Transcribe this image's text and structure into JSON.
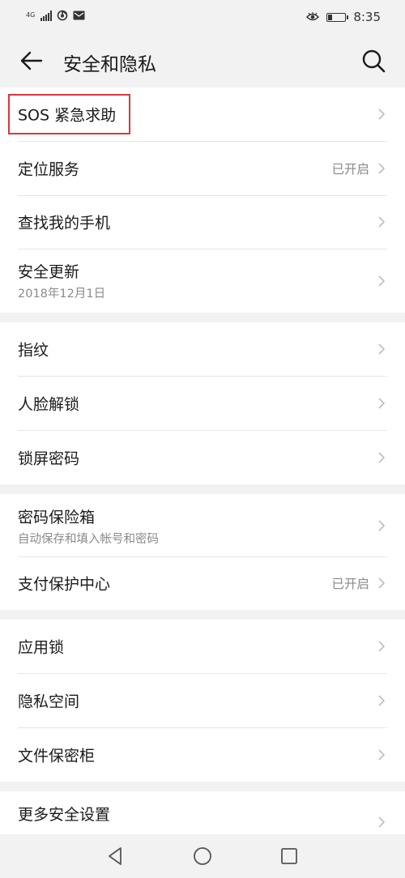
{
  "status_bar": {
    "network": "4G",
    "time": "8:35",
    "battery_level": 0.25,
    "icons": [
      "signal-icon",
      "hotspot-icon",
      "message-icon",
      "eye-comfort-icon",
      "battery-icon"
    ]
  },
  "header": {
    "title": "安全和隐私",
    "back_icon": "arrow-left-icon",
    "search_icon": "search-icon"
  },
  "groups": [
    {
      "items": [
        {
          "label": "SOS 紧急求助",
          "highlighted": true
        },
        {
          "label": "定位服务",
          "value": "已开启"
        },
        {
          "label": "查找我的手机"
        },
        {
          "label": "安全更新",
          "subtitle": "2018年12月1日"
        }
      ]
    },
    {
      "items": [
        {
          "label": "指纹"
        },
        {
          "label": "人脸解锁"
        },
        {
          "label": "锁屏密码"
        }
      ]
    },
    {
      "items": [
        {
          "label": "密码保险箱",
          "subtitle": "自动保存和填入帐号和密码"
        },
        {
          "label": "支付保护中心",
          "value": "已开启"
        }
      ]
    },
    {
      "items": [
        {
          "label": "应用锁"
        },
        {
          "label": "隐私空间"
        },
        {
          "label": "文件保密柜"
        }
      ]
    },
    {
      "items": [
        {
          "label": "更多安全设置"
        }
      ]
    }
  ],
  "nav_bar": {
    "icons": [
      "back-triangle-icon",
      "home-circle-icon",
      "recents-square-icon"
    ]
  },
  "colors": {
    "background": "#f2f2f2",
    "card": "#ffffff",
    "highlight_border": "#d9363e",
    "secondary_text": "#8a8a8a"
  }
}
